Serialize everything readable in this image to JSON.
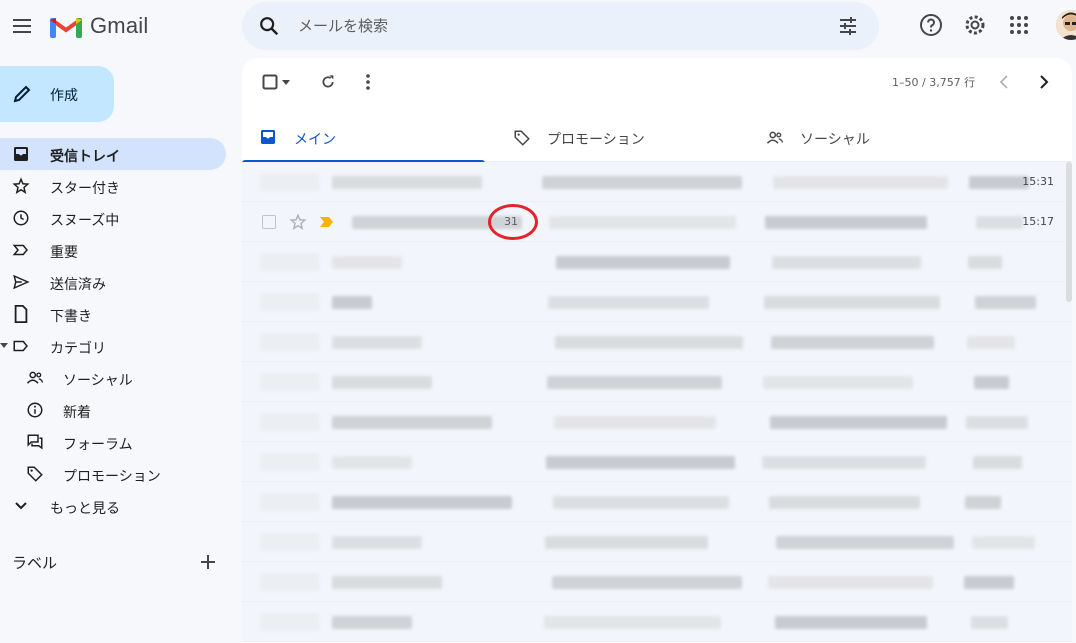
{
  "header": {
    "app_name": "Gmail",
    "search_placeholder": "メールを検索"
  },
  "sidebar": {
    "compose_label": "作成",
    "items": [
      {
        "label": "受信トレイ",
        "icon": "inbox-icon",
        "active": true
      },
      {
        "label": "スター付き",
        "icon": "star-icon"
      },
      {
        "label": "スヌーズ中",
        "icon": "clock-icon"
      },
      {
        "label": "重要",
        "icon": "important-icon"
      },
      {
        "label": "送信済み",
        "icon": "send-icon"
      },
      {
        "label": "下書き",
        "icon": "draft-icon"
      },
      {
        "label": "カテゴリ",
        "icon": "label-icon"
      },
      {
        "label": "ソーシャル",
        "icon": "people-icon"
      },
      {
        "label": "新着",
        "icon": "info-icon"
      },
      {
        "label": "フォーラム",
        "icon": "forum-icon"
      },
      {
        "label": "プロモーション",
        "icon": "tag-icon"
      },
      {
        "label": "もっと見る",
        "icon": "chevron-down-icon"
      }
    ],
    "labels_title": "ラベル"
  },
  "toolbar": {
    "range_text": "1–50 / 3,757 行"
  },
  "tabs": [
    {
      "label": "メイン",
      "icon": "inbox-icon",
      "active": true
    },
    {
      "label": "プロモーション",
      "icon": "tag-icon"
    },
    {
      "label": "ソーシャル",
      "icon": "people-icon"
    }
  ],
  "emails": [
    {
      "time": "15:31"
    },
    {
      "time": "15:17",
      "count": "31"
    },
    {
      "time": ""
    },
    {
      "time": ""
    },
    {
      "time": ""
    },
    {
      "time": ""
    },
    {
      "time": ""
    },
    {
      "time": ""
    },
    {
      "time": ""
    },
    {
      "time": ""
    },
    {
      "time": ""
    },
    {
      "time": ""
    }
  ],
  "colors": {
    "accent": "#0b57d0",
    "compose_bg": "#c2e7ff",
    "active_nav_bg": "#d3e3fd",
    "highlight_circle": "#e3242b"
  }
}
